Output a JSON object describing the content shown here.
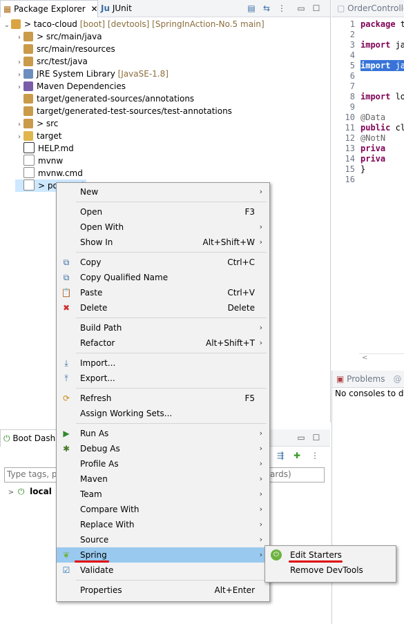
{
  "package_explorer": {
    "tab_title": "Package Explorer",
    "junit_tab": "JUnit",
    "tree": [
      {
        "prefix": "> ",
        "label": "taco-cloud",
        "decoration": " [boot] [devtools] [SpringInAction-No.5 main]"
      },
      {
        "prefix": "> ",
        "label": "src/main/java",
        "decoration": ""
      },
      {
        "prefix": "",
        "label": "src/main/resources",
        "decoration": ""
      },
      {
        "prefix": "",
        "label": "src/test/java",
        "decoration": ""
      },
      {
        "prefix": "",
        "label": "JRE System Library",
        "decoration": " [JavaSE-1.8]"
      },
      {
        "prefix": "",
        "label": "Maven Dependencies",
        "decoration": ""
      },
      {
        "prefix": "",
        "label": "target/generated-sources/annotations",
        "decoration": ""
      },
      {
        "prefix": "",
        "label": "target/generated-test-sources/test-annotations",
        "decoration": ""
      },
      {
        "prefix": "> ",
        "label": "src",
        "decoration": ""
      },
      {
        "prefix": "",
        "label": "target",
        "decoration": ""
      },
      {
        "prefix": "",
        "label": "HELP.md",
        "decoration": ""
      },
      {
        "prefix": "",
        "label": "mvnw",
        "decoration": ""
      },
      {
        "prefix": "",
        "label": "mvnw.cmd",
        "decoration": ""
      },
      {
        "prefix": "> ",
        "label": "pom.xml",
        "decoration": ""
      }
    ]
  },
  "editor": {
    "tab_title": "OrderControlle",
    "lines": [
      {
        "n": "1",
        "text": "package t"
      },
      {
        "n": "2",
        "text": ""
      },
      {
        "n": "3",
        "text": "import ja"
      },
      {
        "n": "4",
        "text": ""
      },
      {
        "n": "5",
        "text": "import ja"
      },
      {
        "n": "6",
        "text": ""
      },
      {
        "n": "7",
        "text": ""
      },
      {
        "n": "8",
        "text": "import lo"
      },
      {
        "n": "9",
        "text": ""
      },
      {
        "n": "10",
        "text": "@Data"
      },
      {
        "n": "11",
        "text": "public cl"
      },
      {
        "n": "12",
        "text": "    @NotN"
      },
      {
        "n": "13",
        "text": "    priva"
      },
      {
        "n": "14",
        "text": "    priva"
      },
      {
        "n": "15",
        "text": "}"
      },
      {
        "n": "16",
        "text": ""
      }
    ]
  },
  "problems": {
    "tab_title": "Problems",
    "message": "No consoles to dis"
  },
  "boot_dashboard": {
    "tab_title": "Boot Dashb",
    "filter_placeholder": "Type tags, pr",
    "filter_suffix": "ards)",
    "local_label": "local"
  },
  "context_menu": {
    "items": [
      {
        "label": "New",
        "accel": "",
        "submenu": true,
        "icon": ""
      },
      {
        "sep": true
      },
      {
        "label": "Open",
        "accel": "F3",
        "submenu": false,
        "icon": ""
      },
      {
        "label": "Open With",
        "accel": "",
        "submenu": true,
        "icon": ""
      },
      {
        "label": "Show In",
        "accel": "Alt+Shift+W",
        "submenu": true,
        "icon": ""
      },
      {
        "sep": true
      },
      {
        "label": "Copy",
        "accel": "Ctrl+C",
        "submenu": false,
        "icon": "copy-icon"
      },
      {
        "label": "Copy Qualified Name",
        "accel": "",
        "submenu": false,
        "icon": "copy-qualified-icon"
      },
      {
        "label": "Paste",
        "accel": "Ctrl+V",
        "submenu": false,
        "icon": "paste-icon"
      },
      {
        "label": "Delete",
        "accel": "Delete",
        "submenu": false,
        "icon": "delete-icon"
      },
      {
        "sep": true
      },
      {
        "label": "Build Path",
        "accel": "",
        "submenu": true,
        "icon": ""
      },
      {
        "label": "Refactor",
        "accel": "Alt+Shift+T",
        "submenu": true,
        "icon": ""
      },
      {
        "sep": true
      },
      {
        "label": "Import...",
        "accel": "",
        "submenu": false,
        "icon": "import-icon"
      },
      {
        "label": "Export...",
        "accel": "",
        "submenu": false,
        "icon": "export-icon"
      },
      {
        "sep": true
      },
      {
        "label": "Refresh",
        "accel": "F5",
        "submenu": false,
        "icon": "refresh-icon"
      },
      {
        "label": "Assign Working Sets...",
        "accel": "",
        "submenu": false,
        "icon": ""
      },
      {
        "sep": true
      },
      {
        "label": "Run As",
        "accel": "",
        "submenu": true,
        "icon": "run-icon"
      },
      {
        "label": "Debug As",
        "accel": "",
        "submenu": true,
        "icon": "debug-icon"
      },
      {
        "label": "Profile As",
        "accel": "",
        "submenu": true,
        "icon": ""
      },
      {
        "label": "Maven",
        "accel": "",
        "submenu": true,
        "icon": ""
      },
      {
        "label": "Team",
        "accel": "",
        "submenu": true,
        "icon": ""
      },
      {
        "label": "Compare With",
        "accel": "",
        "submenu": true,
        "icon": ""
      },
      {
        "label": "Replace With",
        "accel": "",
        "submenu": true,
        "icon": ""
      },
      {
        "label": "Source",
        "accel": "",
        "submenu": true,
        "icon": ""
      },
      {
        "label": "Spring",
        "accel": "",
        "submenu": true,
        "icon": "spring-icon",
        "highlighted": true
      },
      {
        "label": "Validate",
        "accel": "",
        "submenu": false,
        "icon": "checkbox-icon"
      },
      {
        "sep": true
      },
      {
        "label": "Properties",
        "accel": "Alt+Enter",
        "submenu": false,
        "icon": ""
      }
    ]
  },
  "spring_submenu": {
    "items": [
      {
        "label": "Edit Starters",
        "icon": "spring-boot-icon"
      },
      {
        "label": "Remove DevTools",
        "icon": ""
      }
    ]
  },
  "colors": {
    "menu_highlight": "#99c9ef",
    "selection": "#cde8ff",
    "annotation_underline": "#e00000",
    "yellow_marker": "#f2d600"
  }
}
